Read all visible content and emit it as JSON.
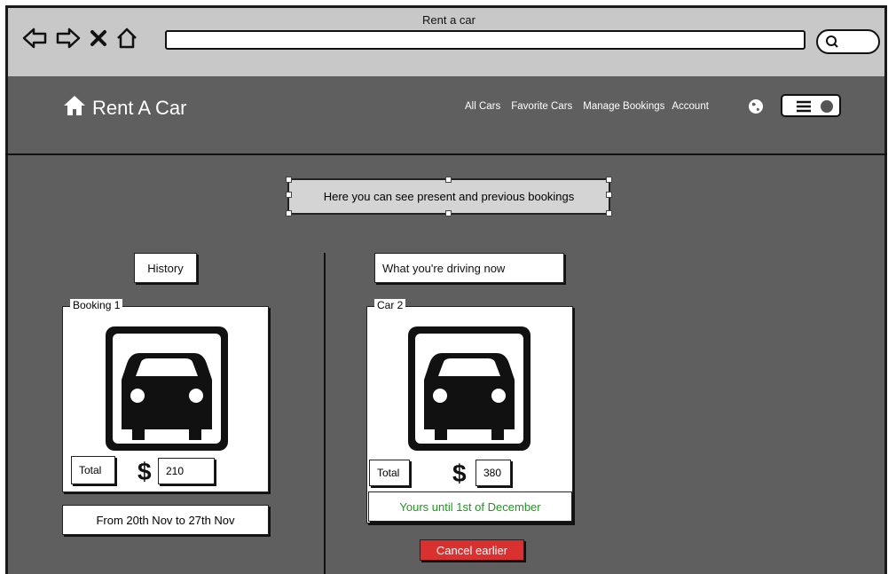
{
  "window": {
    "title": "Rent a car"
  },
  "header": {
    "brand": "Rent A Car",
    "nav": [
      "All Cars",
      "Favorite Cars",
      "Manage Bookings",
      "Account"
    ]
  },
  "banner": {
    "text": "Here you can see present and previous bookings"
  },
  "history": {
    "label": "History",
    "booking": {
      "legend": "Booking 1",
      "total_label": "Total",
      "currency": "$",
      "amount": "210",
      "dates": "From 20th Nov to 27th Nov"
    }
  },
  "current": {
    "label": "What you're driving now",
    "car": {
      "legend": "Car 2",
      "total_label": "Total",
      "currency": "$",
      "amount": "380",
      "until": "Yours until 1st of December"
    },
    "cancel_label": "Cancel earlier"
  },
  "colors": {
    "cancel": "#d93030",
    "until_text": "#1a9a1a",
    "app_bg": "#5f5f5f"
  },
  "icons": [
    "back-arrow-icon",
    "forward-arrow-icon",
    "close-icon",
    "home-outline-icon",
    "search-icon",
    "home-icon",
    "globe-icon",
    "menu-toggle-icon",
    "car-icon"
  ]
}
